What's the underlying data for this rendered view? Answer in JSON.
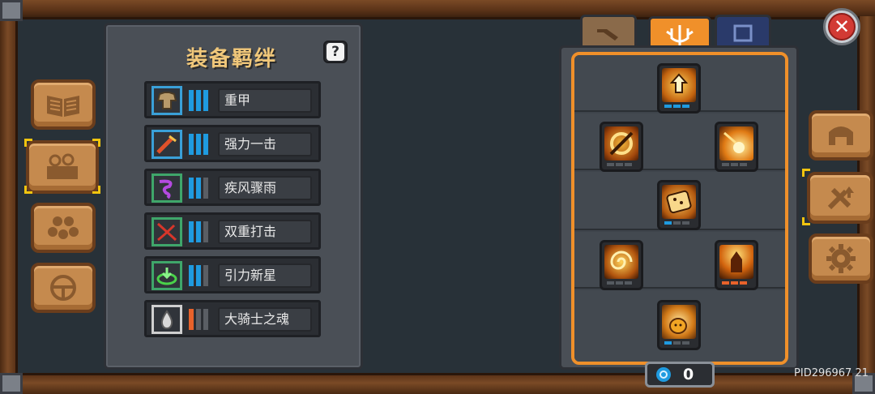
{
  "panel": {
    "title": "装备羁绊",
    "help_label": "?"
  },
  "bonds": [
    {
      "name": "重甲",
      "icon": "heavy-armor-icon",
      "border": "#3aa0d8",
      "bar_color": "#1f9be0",
      "level": 3
    },
    {
      "name": "强力一击",
      "icon": "power-strike-icon",
      "border": "#3aa0d8",
      "bar_color": "#1f9be0",
      "level": 3
    },
    {
      "name": "疾风骤雨",
      "icon": "storm-icon",
      "border": "#3fa66a",
      "bar_color": "#1f9be0",
      "level": 2
    },
    {
      "name": "双重打击",
      "icon": "double-strike-icon",
      "border": "#3fa66a",
      "bar_color": "#1f9be0",
      "level": 2
    },
    {
      "name": "引力新星",
      "icon": "gravity-nova-icon",
      "border": "#3fa66a",
      "bar_color": "#1f9be0",
      "level": 2
    },
    {
      "name": "大骑士之魂",
      "icon": "knight-soul-icon",
      "border": "#cfcfcf",
      "bar_color": "#e8622a",
      "level": 1
    }
  ],
  "counter": {
    "value": "0"
  },
  "footer": {
    "pid": "PID296967  21"
  },
  "colors": {
    "accent": "#f0902a",
    "wood": "#c58a4e"
  }
}
